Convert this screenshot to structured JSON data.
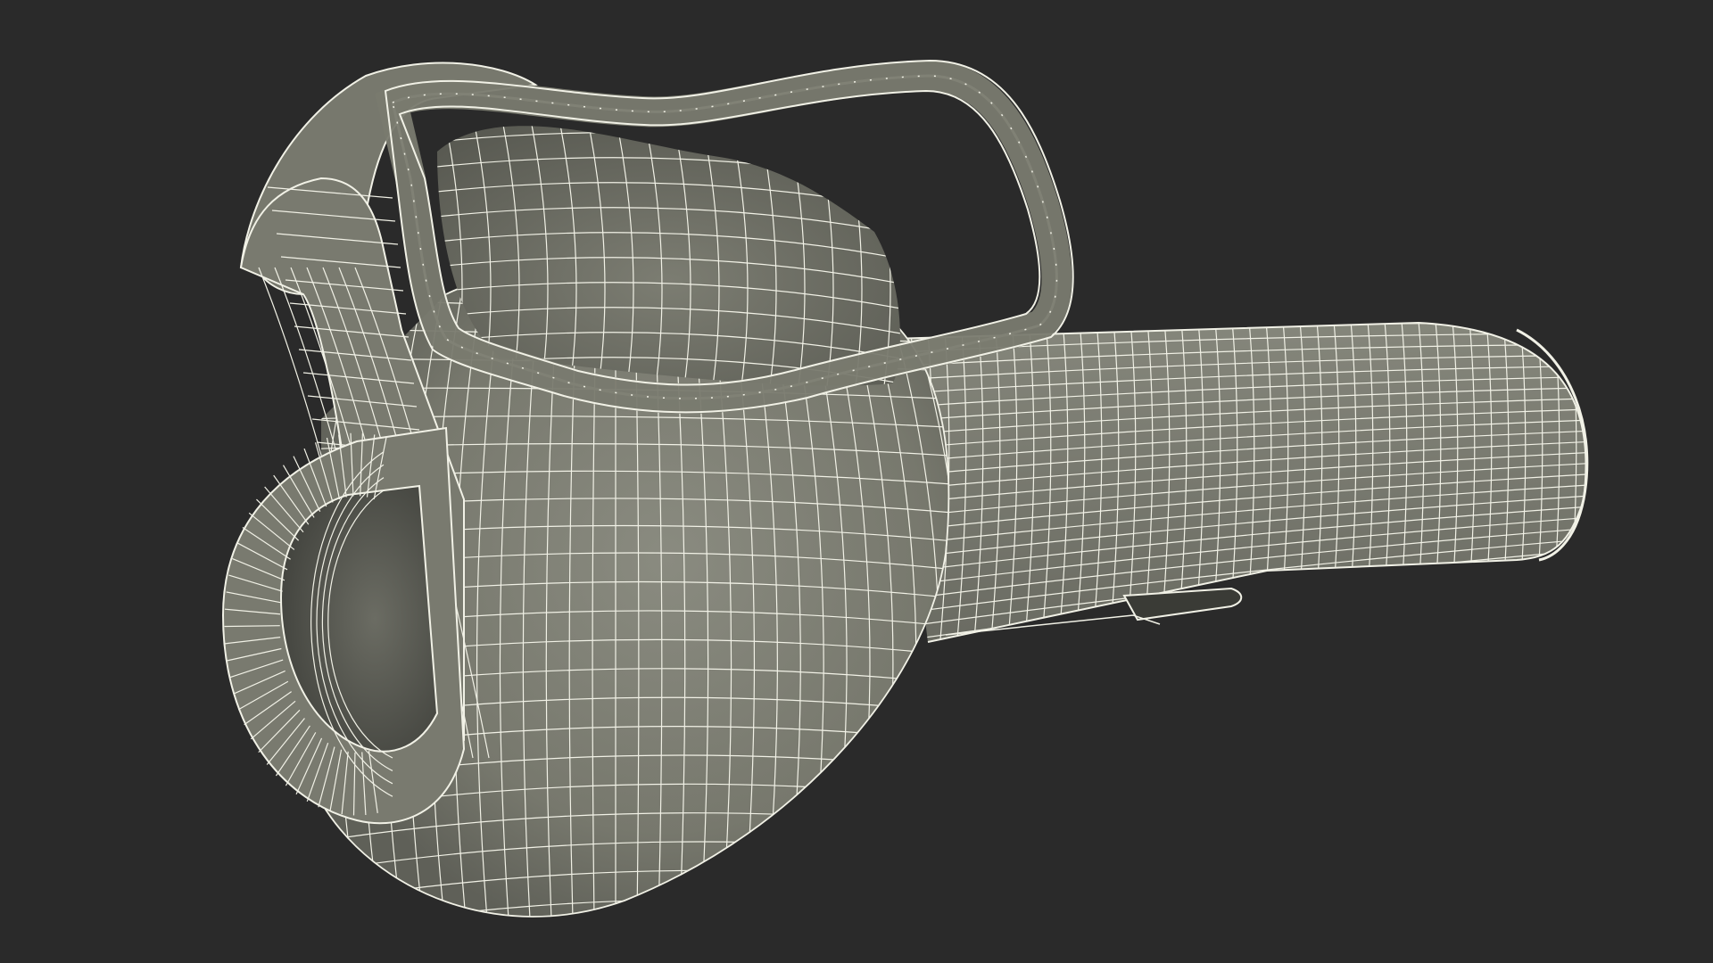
{
  "scene": {
    "subject": "wireframe-3d-model",
    "colors": {
      "background": "#2a2a2a",
      "surface": "#797a6f",
      "surface_dark": "#5d5e56",
      "surface_light": "#8d8e84",
      "wire": "#f1f1e6",
      "interior": "#50514b"
    }
  }
}
